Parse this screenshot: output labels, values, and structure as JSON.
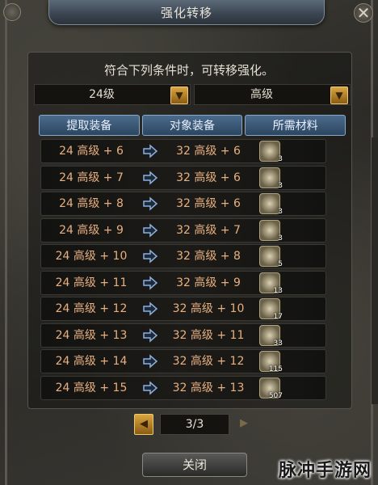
{
  "window": {
    "title": "强化转移",
    "close_glyph": "✕"
  },
  "description": "符合下列条件时，可转移强化。",
  "filters": {
    "level": {
      "value": "24级"
    },
    "grade": {
      "value": "高级"
    }
  },
  "table": {
    "headers": [
      "提取装备",
      "对象装备",
      "所需材料"
    ],
    "rows": [
      {
        "from": "24 高级 + 6",
        "to": "32 高级 + 6",
        "qty": "3"
      },
      {
        "from": "24 高级 + 7",
        "to": "32 高级 + 6",
        "qty": "3"
      },
      {
        "from": "24 高级 + 8",
        "to": "32 高级 + 6",
        "qty": "3"
      },
      {
        "from": "24 高级 + 9",
        "to": "32 高级 + 7",
        "qty": "3"
      },
      {
        "from": "24 高级 + 10",
        "to": "32 高级 + 8",
        "qty": "5"
      },
      {
        "from": "24 高级 + 11",
        "to": "32 高级 + 9",
        "qty": "13"
      },
      {
        "from": "24 高级 + 12",
        "to": "32 高级 + 10",
        "qty": "17"
      },
      {
        "from": "24 高级 + 13",
        "to": "32 高级 + 11",
        "qty": "33"
      },
      {
        "from": "24 高级 + 14",
        "to": "32 高级 + 12",
        "qty": "115"
      },
      {
        "from": "24 高级 + 15",
        "to": "32 高级 + 13",
        "qty": "507"
      }
    ]
  },
  "pager": {
    "text": "3/3"
  },
  "close_button": "关闭",
  "watermark": "脉冲手游网",
  "colors": {
    "accent_gold": "#d9a640",
    "row_text": "#e8b080",
    "header_blue": "#4c6b8c"
  }
}
